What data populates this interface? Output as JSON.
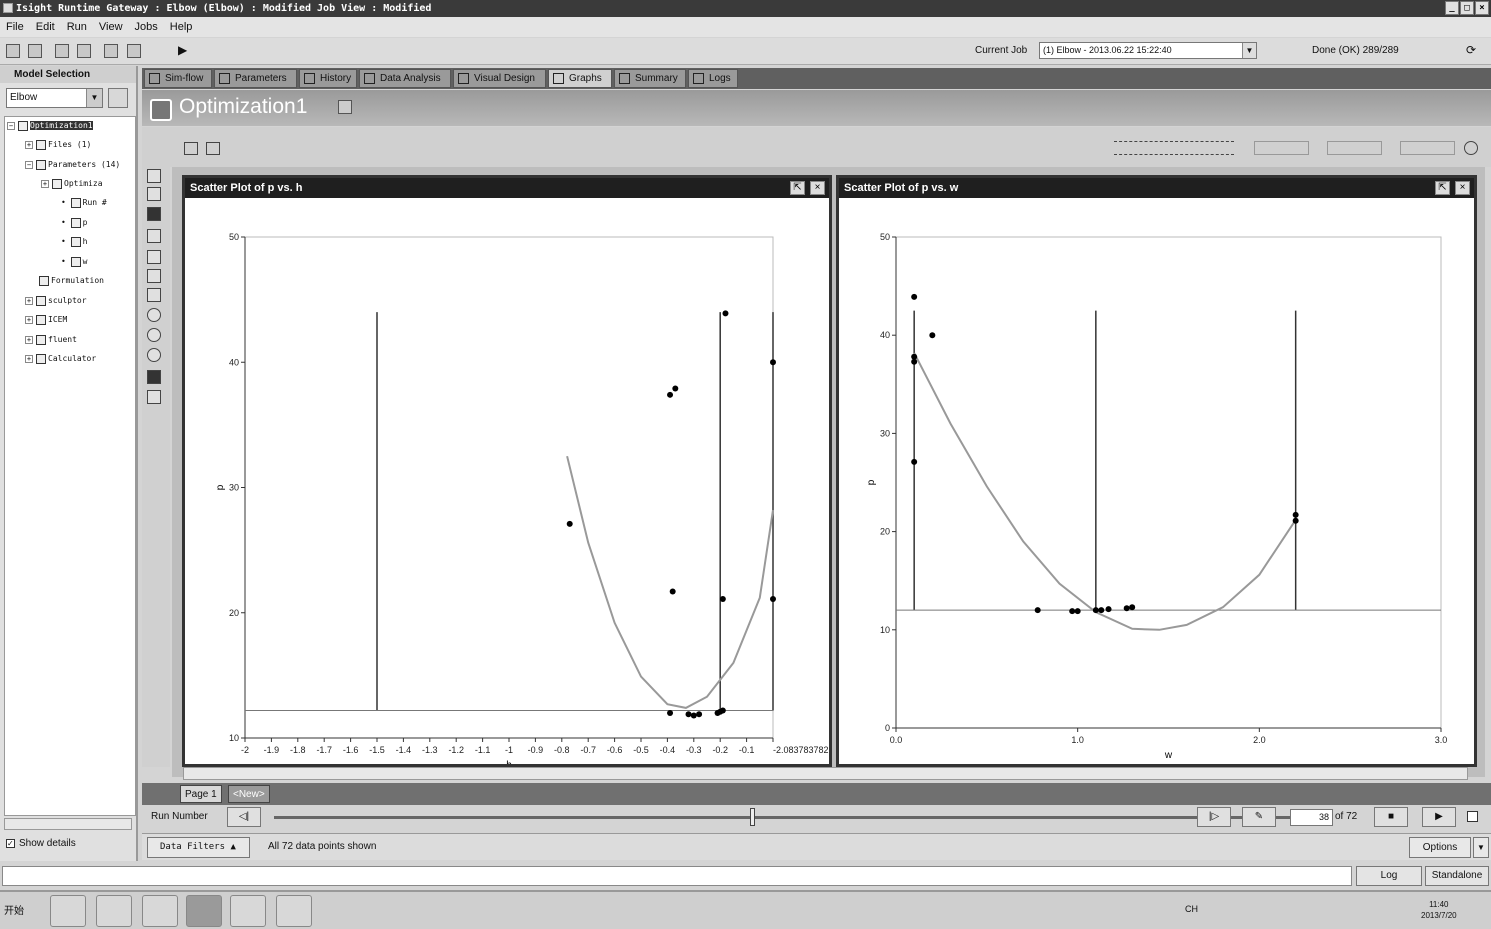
{
  "window": {
    "title": "Isight Runtime Gateway : Elbow (Elbow) : Modified Job View : Modified"
  },
  "menu": [
    "File",
    "Edit",
    "Run",
    "View",
    "Jobs",
    "Help"
  ],
  "toolbar": {
    "current_job_label": "Current Job",
    "current_job_value": "(1) Elbow - 2013.06.22 15:22:40",
    "status": "Done (OK) 289/289"
  },
  "left_panel": {
    "header": "Model Selection",
    "model_value": "Elbow",
    "tree": [
      {
        "label": "Optimization1",
        "selected": true
      },
      {
        "label": "Files (1)"
      },
      {
        "label": "Parameters (14)"
      },
      {
        "label": "Optimiza"
      },
      {
        "label": "Run #"
      },
      {
        "label": "p"
      },
      {
        "label": "h"
      },
      {
        "label": "w"
      },
      {
        "label": "Formulation"
      },
      {
        "label": "sculptor"
      },
      {
        "label": "ICEM"
      },
      {
        "label": "fluent"
      },
      {
        "label": "Calculator"
      }
    ],
    "show_details": "Show details"
  },
  "tabs": [
    "Sim-flow",
    "Parameters",
    "History",
    "Data Analysis",
    "Visual Design",
    "Graphs",
    "Summary",
    "Logs"
  ],
  "active_tab": "Graphs",
  "workflow_title": "Optimization1",
  "pages": {
    "page1": "Page 1",
    "new": "<New>"
  },
  "run": {
    "label": "Run Number",
    "current": "38",
    "of": "of 72"
  },
  "filter": {
    "button": "Data Filters",
    "status": "All 72 data points shown",
    "options": "Options"
  },
  "bottom": {
    "log": "Log",
    "standalone": "Standalone"
  },
  "taskbar": {
    "start": "开始",
    "clock_time": "11:40",
    "clock_date": "2013/7/20",
    "tray_text": "CH"
  },
  "chart_data": [
    {
      "type": "scatter",
      "title": "Scatter Plot of p vs. h",
      "xlabel": "h",
      "ylabel": "p",
      "xlim": [
        -2,
        0
      ],
      "ylim": [
        10,
        50
      ],
      "x_ticks": [
        "-2",
        "-1.9",
        "-1.8",
        "-1.7",
        "-1.6",
        "-1.5",
        "-1.4",
        "-1.3",
        "-1.2",
        "-1.1",
        "-1",
        "-0.9",
        "-0.8",
        "-0.7",
        "-0.6",
        "-0.5",
        "-0.4",
        "-0.3",
        "-0.2",
        "-0.1",
        "-2.083783782E-16"
      ],
      "y_ticks": [
        "10",
        "20",
        "30",
        "40",
        "50"
      ],
      "points": [
        {
          "x": -0.77,
          "y": 27.1
        },
        {
          "x": -0.39,
          "y": 37.4
        },
        {
          "x": -0.37,
          "y": 37.9
        },
        {
          "x": -0.38,
          "y": 21.7
        },
        {
          "x": -0.18,
          "y": 43.9
        },
        {
          "x": -0.19,
          "y": 21.1
        },
        {
          "x": 0.0,
          "y": 21.1
        },
        {
          "x": 0.0,
          "y": 40.0
        },
        {
          "x": -0.39,
          "y": 12.0
        },
        {
          "x": -0.32,
          "y": 11.9
        },
        {
          "x": -0.3,
          "y": 11.8
        },
        {
          "x": -0.28,
          "y": 11.9
        },
        {
          "x": -0.21,
          "y": 12.0
        },
        {
          "x": -0.2,
          "y": 12.1
        },
        {
          "x": -0.19,
          "y": 12.2
        }
      ],
      "fit_curve": [
        {
          "x": -0.78,
          "y": 32.5
        },
        {
          "x": -0.7,
          "y": 25.6
        },
        {
          "x": -0.6,
          "y": 19.2
        },
        {
          "x": -0.5,
          "y": 14.9
        },
        {
          "x": -0.4,
          "y": 12.7
        },
        {
          "x": -0.33,
          "y": 12.4
        },
        {
          "x": -0.25,
          "y": 13.3
        },
        {
          "x": -0.15,
          "y": 16.0
        },
        {
          "x": -0.05,
          "y": 21.2
        },
        {
          "x": 0.0,
          "y": 28.2
        }
      ],
      "reference_lines": {
        "vertical_x": [
          -1.5,
          -0.2,
          0.0
        ],
        "horizontal_y": [
          12.2
        ]
      }
    },
    {
      "type": "scatter",
      "title": "Scatter Plot of p vs. w",
      "xlabel": "w",
      "ylabel": "p",
      "xlim": [
        0,
        3
      ],
      "ylim": [
        0,
        50
      ],
      "x_ticks": [
        "0.0",
        "1.0",
        "2.0",
        "3.0"
      ],
      "y_ticks": [
        "0",
        "10",
        "20",
        "30",
        "40",
        "50"
      ],
      "points": [
        {
          "x": 0.1,
          "y": 43.9
        },
        {
          "x": 0.1,
          "y": 37.8
        },
        {
          "x": 0.1,
          "y": 37.3
        },
        {
          "x": 0.1,
          "y": 27.1
        },
        {
          "x": 0.2,
          "y": 40.0
        },
        {
          "x": 0.78,
          "y": 12.0
        },
        {
          "x": 0.97,
          "y": 11.9
        },
        {
          "x": 1.0,
          "y": 11.9
        },
        {
          "x": 1.1,
          "y": 12.0
        },
        {
          "x": 1.13,
          "y": 12.0
        },
        {
          "x": 1.17,
          "y": 12.1
        },
        {
          "x": 1.27,
          "y": 12.2
        },
        {
          "x": 1.3,
          "y": 12.3
        },
        {
          "x": 2.2,
          "y": 21.1
        },
        {
          "x": 2.2,
          "y": 21.7
        }
      ],
      "fit_curve": [
        {
          "x": 0.1,
          "y": 38.2
        },
        {
          "x": 0.3,
          "y": 31.0
        },
        {
          "x": 0.5,
          "y": 24.6
        },
        {
          "x": 0.7,
          "y": 19.0
        },
        {
          "x": 0.9,
          "y": 14.7
        },
        {
          "x": 1.1,
          "y": 11.8
        },
        {
          "x": 1.3,
          "y": 10.1
        },
        {
          "x": 1.45,
          "y": 10.0
        },
        {
          "x": 1.6,
          "y": 10.5
        },
        {
          "x": 1.8,
          "y": 12.3
        },
        {
          "x": 2.0,
          "y": 15.6
        },
        {
          "x": 2.2,
          "y": 21.2
        }
      ],
      "reference_lines": {
        "vertical_x": [
          0.1,
          1.1,
          2.2
        ],
        "horizontal_y": [
          12.0
        ]
      }
    }
  ]
}
